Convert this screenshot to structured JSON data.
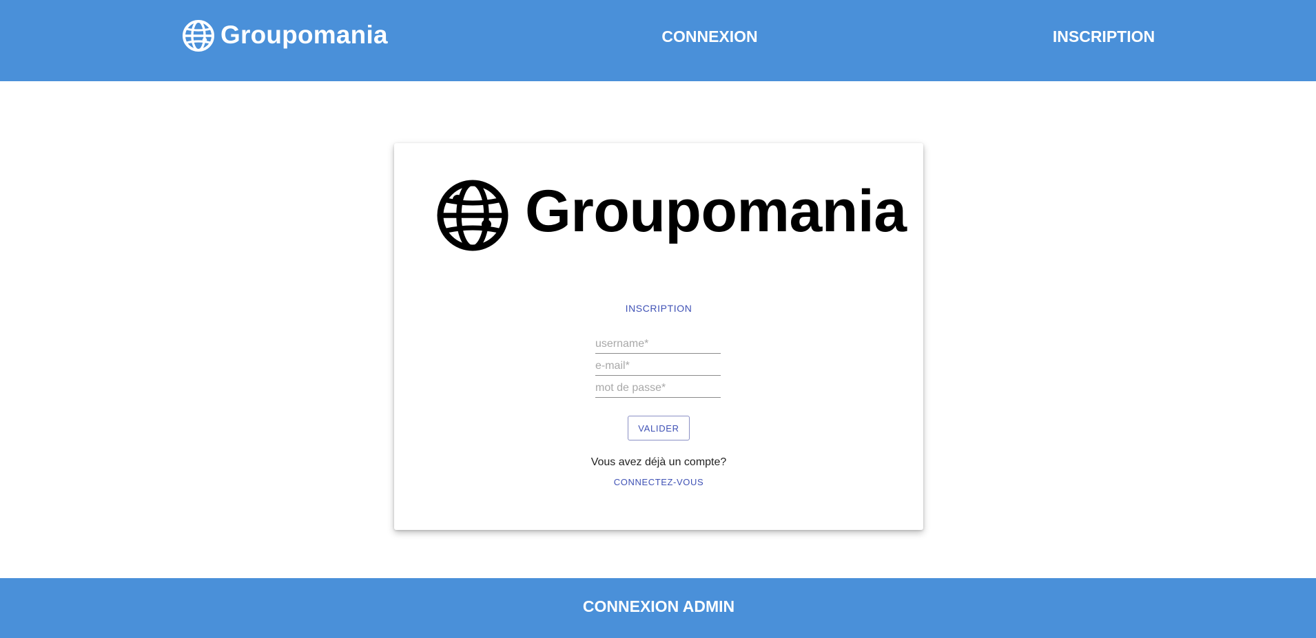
{
  "header": {
    "brand_name": "Groupomania",
    "brand_icon": "globe-icon",
    "nav": {
      "connexion_label": "CONNEXION",
      "inscription_label": "INSCRIPTION"
    }
  },
  "card": {
    "logo_text": "Groupomania",
    "logo_icon": "globe-icon",
    "form": {
      "title": "INSCRIPTION",
      "username_placeholder": "username*",
      "email_placeholder": "e-mail*",
      "password_placeholder": "mot de passe*",
      "submit_label": "VALIDER"
    },
    "already_account_text": "Vous avez déjà un compte?",
    "login_link_label": "CONNECTEZ-VOUS"
  },
  "footer": {
    "admin_link_label": "CONNEXION ADMIN"
  },
  "colors": {
    "header_bg": "#4a90d9",
    "footer_bg": "#4a90d9",
    "accent": "#3f51b5"
  }
}
